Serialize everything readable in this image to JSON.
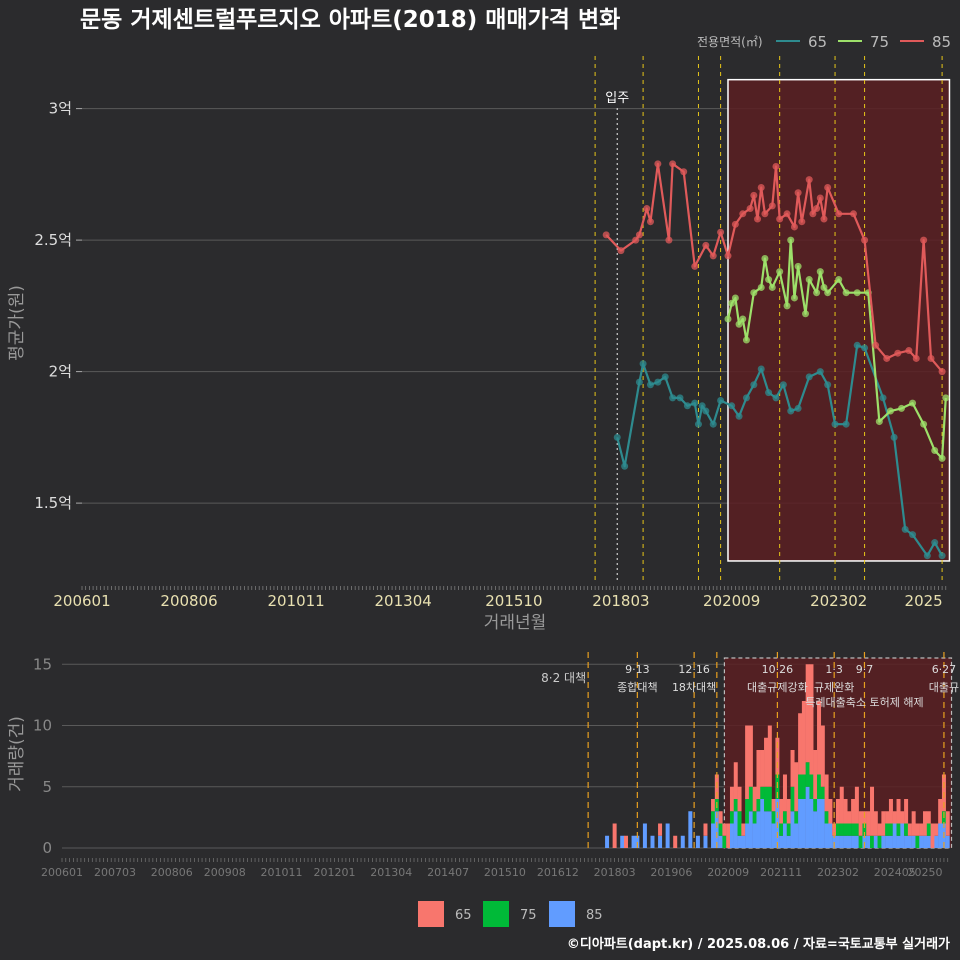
{
  "title": "문동 거제센트럴푸르지오 아파트(2018) 매매가격 변화",
  "footer": "©디아파트(dapt.kr) / 2025.08.06 / 자료=국토교통부 실거래가",
  "colors": {
    "background": "#2b2b2d",
    "grid": "#5a5a5a",
    "price_65": "#2e8b8f",
    "price_75": "#9de06a",
    "price_85": "#e05a5a",
    "vol_65": "#f8766d",
    "vol_75": "#00ba38",
    "vol_85": "#619cff",
    "policy_line": "#e6c619",
    "highlight_fill": "#5a1e22"
  },
  "top_legend": {
    "title": "전용면적(㎡)",
    "items": [
      {
        "label": "65",
        "color": "#2e8b8f"
      },
      {
        "label": "75",
        "color": "#9de06a"
      },
      {
        "label": "85",
        "color": "#e05a5a"
      }
    ]
  },
  "bottom_legend": {
    "items": [
      {
        "label": "65",
        "color": "#f8766d"
      },
      {
        "label": "75",
        "color": "#00ba38"
      },
      {
        "label": "85",
        "color": "#619cff"
      }
    ]
  },
  "chart_data": [
    {
      "type": "line",
      "xlabel": "거래년월",
      "ylabel": "평균가(원)",
      "x_ticks": [
        "200601",
        "200806",
        "201011",
        "201304",
        "201510",
        "201803",
        "202009",
        "202302",
        "2025"
      ],
      "y_ticks": [
        {
          "value": 1.5,
          "label": "1.5억"
        },
        {
          "value": 2,
          "label": "2억"
        },
        {
          "value": 2.5,
          "label": "2.5억"
        },
        {
          "value": 3,
          "label": "3억"
        }
      ],
      "y_unit": "억",
      "ylim": [
        1.2,
        3.2
      ],
      "annotation": {
        "label": "입주",
        "x": "2018-02"
      },
      "series": [
        {
          "name": "65",
          "points": [
            [
              "2018-02",
              1.75
            ],
            [
              "2018-04",
              1.64
            ],
            [
              "2018-08",
              1.96
            ],
            [
              "2018-09",
              2.03
            ],
            [
              "2018-11",
              1.95
            ],
            [
              "2019-01",
              1.96
            ],
            [
              "2019-03",
              1.98
            ],
            [
              "2019-05",
              1.9
            ],
            [
              "2019-07",
              1.9
            ],
            [
              "2019-09",
              1.87
            ],
            [
              "2019-11",
              1.88
            ],
            [
              "2019-12",
              1.8
            ],
            [
              "2020-01",
              1.87
            ],
            [
              "2020-02",
              1.85
            ],
            [
              "2020-04",
              1.8
            ],
            [
              "2020-06",
              1.89
            ],
            [
              "2020-09",
              1.87
            ],
            [
              "2020-11",
              1.83
            ],
            [
              "2021-01",
              1.9
            ],
            [
              "2021-03",
              1.95
            ],
            [
              "2021-05",
              2.01
            ],
            [
              "2021-07",
              1.92
            ],
            [
              "2021-09",
              1.9
            ],
            [
              "2021-11",
              1.95
            ],
            [
              "2022-01",
              1.85
            ],
            [
              "2022-03",
              1.86
            ],
            [
              "2022-06",
              1.98
            ],
            [
              "2022-09",
              2.0
            ],
            [
              "2022-11",
              1.95
            ],
            [
              "2023-01",
              1.8
            ],
            [
              "2023-04",
              1.8
            ],
            [
              "2023-07",
              2.1
            ],
            [
              "2023-09",
              2.09
            ],
            [
              "2024-02",
              1.9
            ],
            [
              "2024-05",
              1.75
            ],
            [
              "2024-08",
              1.4
            ],
            [
              "2024-10",
              1.38
            ],
            [
              "2025-02",
              1.3
            ],
            [
              "2025-04",
              1.35
            ],
            [
              "2025-06",
              1.3
            ]
          ]
        },
        {
          "name": "75",
          "points": [
            [
              "2020-08",
              2.2
            ],
            [
              "2020-09",
              2.26
            ],
            [
              "2020-10",
              2.28
            ],
            [
              "2020-11",
              2.18
            ],
            [
              "2020-12",
              2.2
            ],
            [
              "2021-01",
              2.12
            ],
            [
              "2021-03",
              2.3
            ],
            [
              "2021-05",
              2.32
            ],
            [
              "2021-06",
              2.43
            ],
            [
              "2021-07",
              2.35
            ],
            [
              "2021-08",
              2.32
            ],
            [
              "2021-10",
              2.38
            ],
            [
              "2021-12",
              2.25
            ],
            [
              "2022-01",
              2.5
            ],
            [
              "2022-02",
              2.28
            ],
            [
              "2022-03",
              2.4
            ],
            [
              "2022-05",
              2.22
            ],
            [
              "2022-06",
              2.35
            ],
            [
              "2022-08",
              2.3
            ],
            [
              "2022-09",
              2.38
            ],
            [
              "2022-10",
              2.32
            ],
            [
              "2022-11",
              2.3
            ],
            [
              "2023-02",
              2.35
            ],
            [
              "2023-04",
              2.3
            ],
            [
              "2023-07",
              2.3
            ],
            [
              "2023-10",
              2.3
            ],
            [
              "2024-01",
              1.81
            ],
            [
              "2024-04",
              1.85
            ],
            [
              "2024-07",
              1.86
            ],
            [
              "2024-10",
              1.88
            ],
            [
              "2025-01",
              1.8
            ],
            [
              "2025-04",
              1.7
            ],
            [
              "2025-06",
              1.67
            ],
            [
              "2025-07",
              1.9
            ]
          ]
        },
        {
          "name": "85",
          "points": [
            [
              "2017-11",
              2.52
            ],
            [
              "2018-03",
              2.46
            ],
            [
              "2018-07",
              2.5
            ],
            [
              "2018-08",
              2.52
            ],
            [
              "2018-10",
              2.62
            ],
            [
              "2018-11",
              2.57
            ],
            [
              "2019-01",
              2.79
            ],
            [
              "2019-04",
              2.5
            ],
            [
              "2019-05",
              2.79
            ],
            [
              "2019-08",
              2.76
            ],
            [
              "2019-11",
              2.4
            ],
            [
              "2020-02",
              2.48
            ],
            [
              "2020-04",
              2.44
            ],
            [
              "2020-06",
              2.53
            ],
            [
              "2020-08",
              2.44
            ],
            [
              "2020-10",
              2.56
            ],
            [
              "2020-12",
              2.6
            ],
            [
              "2021-02",
              2.62
            ],
            [
              "2021-03",
              2.67
            ],
            [
              "2021-04",
              2.58
            ],
            [
              "2021-05",
              2.7
            ],
            [
              "2021-06",
              2.6
            ],
            [
              "2021-08",
              2.63
            ],
            [
              "2021-09",
              2.78
            ],
            [
              "2021-10",
              2.58
            ],
            [
              "2021-12",
              2.6
            ],
            [
              "2022-02",
              2.55
            ],
            [
              "2022-03",
              2.68
            ],
            [
              "2022-04",
              2.57
            ],
            [
              "2022-06",
              2.73
            ],
            [
              "2022-07",
              2.6
            ],
            [
              "2022-08",
              2.62
            ],
            [
              "2022-09",
              2.66
            ],
            [
              "2022-10",
              2.58
            ],
            [
              "2022-11",
              2.7
            ],
            [
              "2023-02",
              2.6
            ],
            [
              "2023-06",
              2.6
            ],
            [
              "2023-09",
              2.5
            ],
            [
              "2023-12",
              2.1
            ],
            [
              "2024-03",
              2.05
            ],
            [
              "2024-06",
              2.07
            ],
            [
              "2024-09",
              2.08
            ],
            [
              "2024-11",
              2.05
            ],
            [
              "2025-01",
              2.5
            ],
            [
              "2025-03",
              2.05
            ],
            [
              "2025-06",
              2.0
            ]
          ]
        }
      ],
      "policy_lines": [
        "2017-08",
        "2018-09",
        "2019-12",
        "2020-06",
        "2021-10",
        "2023-01",
        "2023-09",
        "2025-06"
      ],
      "highlight": {
        "from": "2020-08",
        "to": "2025-08",
        "ymin": 1.28,
        "ymax": 3.11
      }
    },
    {
      "type": "bar",
      "xlabel": "",
      "ylabel": "거래량(건)",
      "x_ticks": [
        "200601",
        "200703",
        "200806",
        "200908",
        "201011",
        "201201",
        "201304",
        "201407",
        "201510",
        "201612",
        "201803",
        "201906",
        "202009",
        "202111",
        "202302",
        "202405",
        "20250"
      ],
      "y_ticks": [
        0,
        5,
        10,
        15
      ],
      "ylim": [
        0,
        16
      ],
      "series_names": [
        "65",
        "75",
        "85"
      ],
      "bars": [
        [
          "2018-01",
          0,
          0,
          1
        ],
        [
          "2018-03",
          2,
          0,
          0
        ],
        [
          "2018-05",
          0,
          0,
          1
        ],
        [
          "2018-06",
          1,
          0,
          0
        ],
        [
          "2018-08",
          0,
          0,
          1
        ],
        [
          "2018-09",
          0,
          0,
          1
        ],
        [
          "2018-11",
          0,
          0,
          2
        ],
        [
          "2019-01",
          0,
          0,
          1
        ],
        [
          "2019-03",
          1,
          0,
          1
        ],
        [
          "2019-05",
          0,
          0,
          2
        ],
        [
          "2019-07",
          1,
          0,
          0
        ],
        [
          "2019-09",
          0,
          0,
          1
        ],
        [
          "2019-11",
          0,
          0,
          3
        ],
        [
          "2020-01",
          0,
          0,
          1
        ],
        [
          "2020-03",
          1,
          0,
          1
        ],
        [
          "2020-05",
          1,
          1,
          2
        ],
        [
          "2020-06",
          2,
          1,
          3
        ],
        [
          "2020-07",
          1,
          1,
          1
        ],
        [
          "2020-08",
          1,
          1,
          0
        ],
        [
          "2020-09",
          2,
          0,
          0
        ],
        [
          "2020-10",
          2,
          1,
          2
        ],
        [
          "2020-11",
          3,
          1,
          3
        ],
        [
          "2020-12",
          2,
          2,
          1
        ],
        [
          "2021-01",
          1,
          0,
          1
        ],
        [
          "2021-02",
          6,
          2,
          2
        ],
        [
          "2021-03",
          5,
          2,
          3
        ],
        [
          "2021-04",
          2,
          1,
          2
        ],
        [
          "2021-05",
          4,
          1,
          3
        ],
        [
          "2021-06",
          3,
          1,
          4
        ],
        [
          "2021-07",
          4,
          2,
          3
        ],
        [
          "2021-08",
          5,
          2,
          3
        ],
        [
          "2021-09",
          1,
          1,
          2
        ],
        [
          "2021-10",
          3,
          2,
          4
        ],
        [
          "2021-11",
          2,
          1,
          1
        ],
        [
          "2021-12",
          3,
          1,
          2
        ],
        [
          "2022-01",
          2,
          1,
          1
        ],
        [
          "2022-02",
          3,
          2,
          3
        ],
        [
          "2022-03",
          4,
          1,
          2
        ],
        [
          "2022-04",
          5,
          2,
          4
        ],
        [
          "2022-05",
          6,
          2,
          4
        ],
        [
          "2022-06",
          8,
          2,
          5
        ],
        [
          "2022-07",
          9,
          2,
          4
        ],
        [
          "2022-08",
          4,
          1,
          3
        ],
        [
          "2022-09",
          6,
          2,
          4
        ],
        [
          "2022-10",
          5,
          1,
          4
        ],
        [
          "2022-11",
          3,
          1,
          2
        ],
        [
          "2022-12",
          2,
          0,
          2
        ],
        [
          "2023-01",
          1,
          0,
          1
        ],
        [
          "2023-02",
          2,
          1,
          1
        ],
        [
          "2023-03",
          3,
          1,
          1
        ],
        [
          "2023-04",
          2,
          1,
          1
        ],
        [
          "2023-05",
          1,
          1,
          1
        ],
        [
          "2023-06",
          2,
          1,
          1
        ],
        [
          "2023-07",
          3,
          1,
          1
        ],
        [
          "2023-08",
          2,
          1,
          0
        ],
        [
          "2023-09",
          1,
          1,
          1
        ],
        [
          "2023-10",
          2,
          0,
          1
        ],
        [
          "2023-11",
          4,
          1,
          0
        ],
        [
          "2023-12",
          2,
          0,
          1
        ],
        [
          "2024-01",
          1,
          1,
          0
        ],
        [
          "2024-02",
          2,
          0,
          1
        ],
        [
          "2024-03",
          1,
          1,
          1
        ],
        [
          "2024-04",
          2,
          1,
          1
        ],
        [
          "2024-05",
          1,
          0,
          2
        ],
        [
          "2024-06",
          2,
          1,
          1
        ],
        [
          "2024-07",
          1,
          0,
          2
        ],
        [
          "2024-08",
          2,
          1,
          1
        ],
        [
          "2024-09",
          1,
          0,
          1
        ],
        [
          "2024-10",
          2,
          0,
          1
        ],
        [
          "2024-11",
          1,
          1,
          0
        ],
        [
          "2024-12",
          1,
          0,
          1
        ],
        [
          "2025-01",
          2,
          0,
          1
        ],
        [
          "2025-02",
          1,
          1,
          1
        ],
        [
          "2025-03",
          2,
          0,
          0
        ],
        [
          "2025-04",
          1,
          0,
          1
        ],
        [
          "2025-05",
          2,
          0,
          2
        ],
        [
          "2025-06",
          3,
          1,
          2
        ],
        [
          "2025-07",
          2,
          0,
          1
        ]
      ],
      "policy_events": [
        {
          "x": "2017-08",
          "label": "8·2 대책",
          "row": 2
        },
        {
          "x": "2018-09",
          "label": "9·13 종합대책",
          "row": 1
        },
        {
          "x": "2019-12",
          "label": "12·16 18차대책",
          "row": 1
        },
        {
          "x": "2020-06",
          "label": "",
          "row": 0
        },
        {
          "x": "2021-10",
          "label": "10·26 대출규제강화",
          "row": 1
        },
        {
          "x": "2023-01",
          "label": "1·3 규제완화",
          "row": 1
        },
        {
          "x": "2023-09",
          "label": "9·7 특례대출축소 토허제 해제",
          "row": 2
        },
        {
          "x": "2025-06",
          "label": "6·27 대출규",
          "row": 1
        }
      ],
      "highlight": {
        "from": "2020-08",
        "to": "2025-08",
        "ymax": 16
      }
    }
  ]
}
